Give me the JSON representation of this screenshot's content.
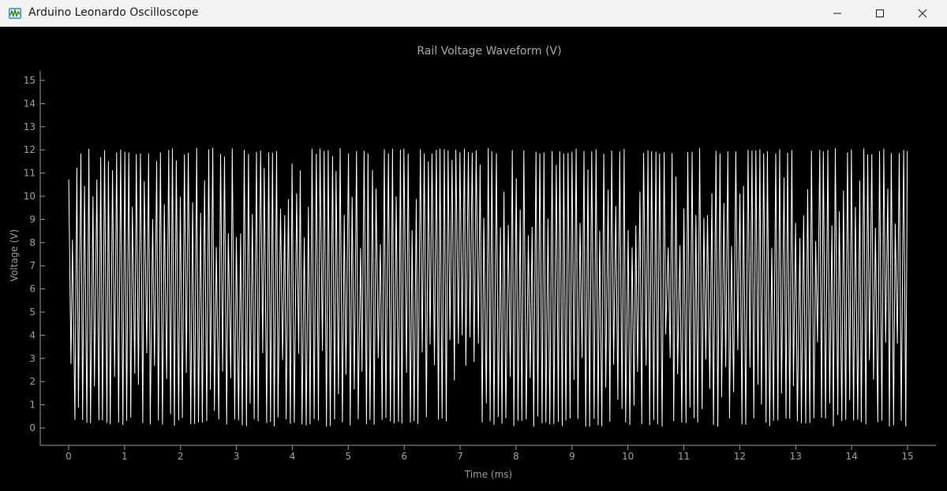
{
  "window": {
    "title": "Arduino Leonardo Oscilloscope",
    "icon": "oscilloscope-app-icon",
    "controls": [
      "minimize-icon",
      "maximize-icon",
      "close-icon"
    ]
  },
  "colors": {
    "background": "#000000",
    "trace": "#ffffff",
    "axis": "#9a9a9a",
    "text": "#a0a0a0",
    "titlebar": "#f3f3f3"
  },
  "chart_data": {
    "type": "line",
    "title": "Rail Voltage Waveform (V)",
    "xlabel": "Time (ms)",
    "ylabel": "Voltage (V)",
    "xlim": [
      0,
      15
    ],
    "ylim": [
      0,
      15
    ],
    "xticks": [
      0,
      1,
      2,
      3,
      4,
      5,
      6,
      7,
      8,
      9,
      10,
      11,
      12,
      13,
      14,
      15
    ],
    "yticks": [
      0,
      1,
      2,
      3,
      4,
      5,
      6,
      7,
      8,
      9,
      10,
      11,
      12,
      13,
      14,
      15
    ],
    "grid": false,
    "legend": "none",
    "series": [
      {
        "style": "white line",
        "description_of_signal": "noisy oscillating waveform swinging between about 0 V and 12 V",
        "x_start": 0,
        "x_end": 15,
        "min": 0.05,
        "max": 12.1,
        "cycles_approx": 210
      }
    ]
  }
}
